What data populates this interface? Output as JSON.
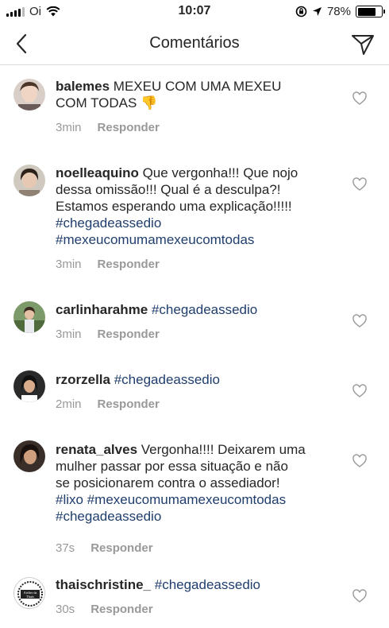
{
  "status_bar": {
    "carrier": "Oi",
    "time": "10:07",
    "battery_percent": "78%",
    "battery_level": 0.78,
    "icons": [
      "signal-icon",
      "wifi-icon",
      "orientation-lock-icon",
      "location-icon",
      "battery-icon"
    ]
  },
  "header": {
    "title": "Comentários",
    "back_icon": "chevron-left-icon",
    "send_icon": "send-paper-plane-icon"
  },
  "reply_label": "Responder",
  "comments": [
    {
      "username": "balemes",
      "lines": [
        [
          "MEXEU COM UMA MEXEU"
        ],
        [
          "COM TODAS 👎"
        ]
      ],
      "time": "3min"
    },
    {
      "username": "noelleaquino",
      "line1": "Que vergonha!!! Que nojo",
      "line2": "dessa omissão!!! Qual é a desculpa?!",
      "line3": "Estamos esperando uma explicação!!!!!",
      "line4": "#chegadeassedio",
      "line5": "#mexeucomumamexeucomtodas",
      "time": "3min"
    },
    {
      "username": "carlinharahme",
      "tag": "#chegadeassedio",
      "time": "3min"
    },
    {
      "username": "rzorzella",
      "tag": "#chegadeassedio",
      "time": "2min"
    },
    {
      "username": "renata_alves",
      "line1": "Vergonha!!!! Deixarem uma",
      "line2": "mulher passar por essa situação e não",
      "line3": "se posicionarem contra o assediador!",
      "line4a": "#lixo",
      "line4b": "#mexeucomumamexeucomtodas",
      "line5": "#chegadeassedio",
      "time": "37s"
    },
    {
      "username": "thaischristine_",
      "tag": "#chegadeassedio",
      "time": "30s",
      "avatar_text": "Atelier da Thaís"
    }
  ],
  "colors": {
    "hashtag": "#1f3e6d",
    "meta": "#999999",
    "text": "#262626",
    "divider": "#dbdbdb"
  }
}
